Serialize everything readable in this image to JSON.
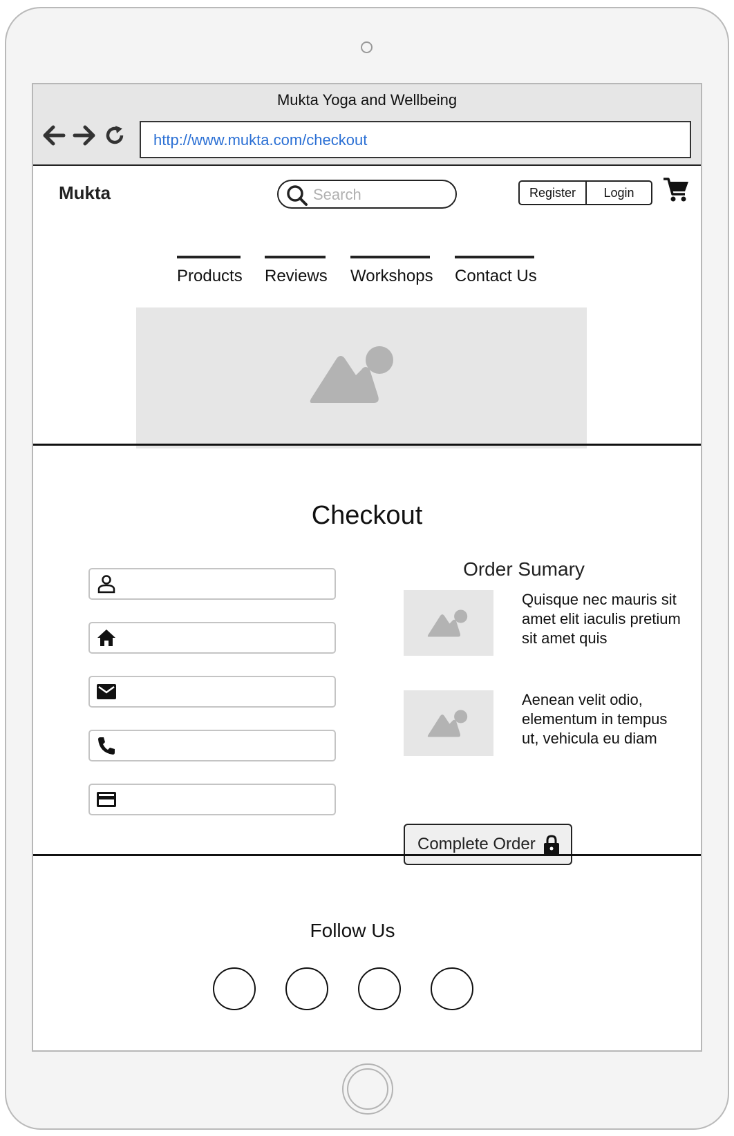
{
  "browser": {
    "window_title": "Mukta Yoga and Wellbeing",
    "url": "http://www.mukta.com/checkout",
    "icons": [
      "back-arrow-icon",
      "forward-arrow-icon",
      "reload-icon"
    ]
  },
  "header": {
    "brand": "Mukta",
    "search_placeholder": "Search",
    "register_label": "Register",
    "login_label": "Login",
    "cart_icon": "shopping-cart-icon"
  },
  "nav": {
    "items": [
      "Products",
      "Reviews",
      "Workshops",
      "Contact Us"
    ]
  },
  "checkout": {
    "title": "Checkout",
    "fields": [
      {
        "icon": "person-icon",
        "value": ""
      },
      {
        "icon": "home-icon",
        "value": ""
      },
      {
        "icon": "mail-icon",
        "value": ""
      },
      {
        "icon": "phone-icon",
        "value": ""
      },
      {
        "icon": "credit-card-icon",
        "value": ""
      }
    ],
    "summary": {
      "title": "Order Sumary",
      "items": [
        {
          "text": "Quisque nec mauris sit amet elit iaculis pretium sit amet quis"
        },
        {
          "text": "Aenean velit odio, elementum in tempus ut, vehicula eu diam"
        }
      ]
    },
    "complete_button_label": "Complete Order"
  },
  "footer": {
    "follow_title": "Follow Us",
    "social_count": 4
  },
  "colors": {
    "link": "#2a6fd4",
    "placeholder_bg": "#e6e6e6",
    "placeholder_icon": "#b3b3b3",
    "frame": "#f4f4f4"
  }
}
